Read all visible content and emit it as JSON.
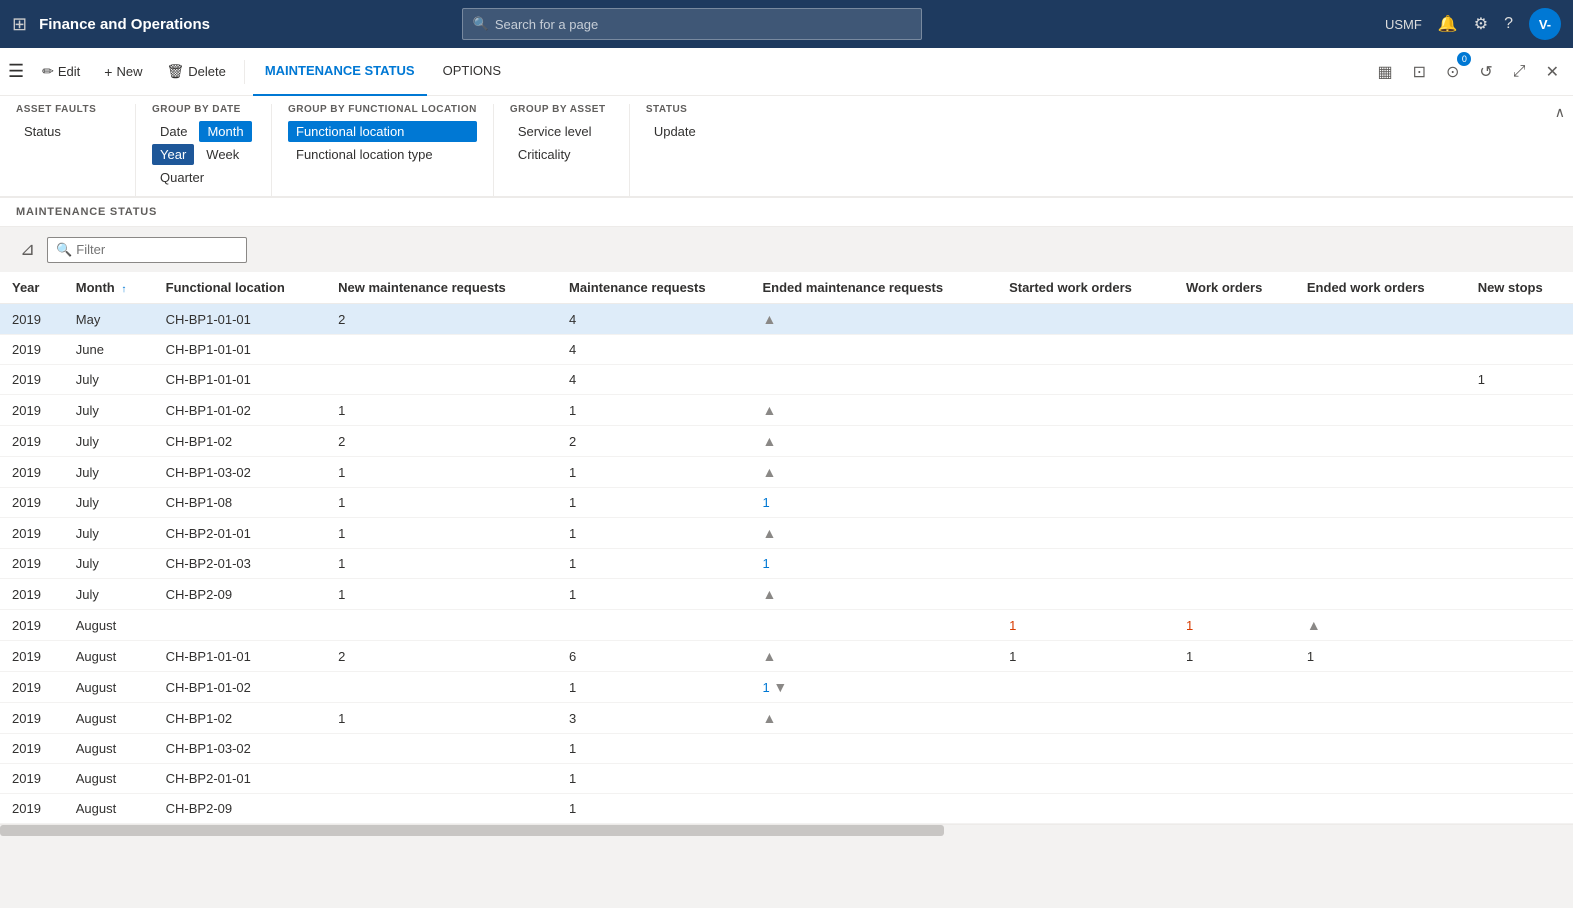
{
  "app": {
    "title": "Finance and Operations",
    "search_placeholder": "Search for a page"
  },
  "top_bar": {
    "username": "USMF",
    "avatar_initials": "V-",
    "notification_count": "0"
  },
  "command_bar": {
    "edit_label": "Edit",
    "new_label": "New",
    "delete_label": "Delete",
    "tab_maintenance": "MAINTENANCE STATUS",
    "tab_options": "OPTIONS"
  },
  "ribbon": {
    "asset_faults": {
      "title": "ASSET FAULTS",
      "items": [
        "Status"
      ]
    },
    "group_by_date": {
      "title": "GROUP BY DATE",
      "items": [
        "Date",
        "Month",
        "Year",
        "Week",
        "Quarter"
      ],
      "selected": "Month",
      "secondary_selected": "Year"
    },
    "group_by_functional_location": {
      "title": "GROUP BY FUNCTIONAL LOCATION",
      "items": [
        "Functional location",
        "Functional location type"
      ],
      "selected": "Functional location"
    },
    "group_by_asset": {
      "title": "GROUP BY ASSET",
      "items": [
        "Service level",
        "Criticality"
      ]
    },
    "status": {
      "title": "STATUS",
      "items": [
        "Update"
      ]
    }
  },
  "section": {
    "title": "MAINTENANCE STATUS"
  },
  "filter": {
    "placeholder": "Filter"
  },
  "table": {
    "columns": [
      "Year",
      "Month",
      "Functional location",
      "New maintenance requests",
      "Maintenance requests",
      "Ended maintenance requests",
      "Started work orders",
      "Work orders",
      "Ended work orders",
      "New stops"
    ],
    "rows": [
      {
        "year": "2019",
        "month": "May",
        "location": "CH-BP1-01-01",
        "new_mr": "2",
        "mr": "4",
        "ended_mr": "▲",
        "started_wo": "",
        "wo": "",
        "ended_wo": "",
        "new_stops": "",
        "selected": true
      },
      {
        "year": "2019",
        "month": "June",
        "location": "CH-BP1-01-01",
        "new_mr": "",
        "mr": "4",
        "ended_mr": "",
        "started_wo": "",
        "wo": "",
        "ended_wo": "",
        "new_stops": ""
      },
      {
        "year": "2019",
        "month": "July",
        "location": "CH-BP1-01-01",
        "new_mr": "",
        "mr": "4",
        "ended_mr": "",
        "started_wo": "",
        "wo": "",
        "ended_wo": "",
        "new_stops": "1"
      },
      {
        "year": "2019",
        "month": "July",
        "location": "CH-BP1-01-02",
        "new_mr": "1",
        "mr": "1",
        "ended_mr": "▲",
        "started_wo": "",
        "wo": "",
        "ended_wo": "",
        "new_stops": ""
      },
      {
        "year": "2019",
        "month": "July",
        "location": "CH-BP1-02",
        "new_mr": "2",
        "mr": "2",
        "ended_mr": "▲",
        "started_wo": "",
        "wo": "",
        "ended_wo": "",
        "new_stops": ""
      },
      {
        "year": "2019",
        "month": "July",
        "location": "CH-BP1-03-02",
        "new_mr": "1",
        "mr": "1",
        "ended_mr": "▲",
        "started_wo": "",
        "wo": "",
        "ended_wo": "",
        "new_stops": ""
      },
      {
        "year": "2019",
        "month": "July",
        "location": "CH-BP1-08",
        "new_mr": "1",
        "mr": "1",
        "ended_mr": "1",
        "started_wo": "",
        "wo": "",
        "ended_wo": "",
        "new_stops": ""
      },
      {
        "year": "2019",
        "month": "July",
        "location": "CH-BP2-01-01",
        "new_mr": "1",
        "mr": "1",
        "ended_mr": "▲",
        "started_wo": "",
        "wo": "",
        "ended_wo": "",
        "new_stops": ""
      },
      {
        "year": "2019",
        "month": "July",
        "location": "CH-BP2-01-03",
        "new_mr": "1",
        "mr": "1",
        "ended_mr": "1",
        "started_wo": "",
        "wo": "",
        "ended_wo": "",
        "new_stops": ""
      },
      {
        "year": "2019",
        "month": "July",
        "location": "CH-BP2-09",
        "new_mr": "1",
        "mr": "1",
        "ended_mr": "▲",
        "started_wo": "",
        "wo": "",
        "ended_wo": "",
        "new_stops": ""
      },
      {
        "year": "2019",
        "month": "August",
        "location": "",
        "new_mr": "",
        "mr": "",
        "ended_mr": "",
        "started_wo": "1",
        "wo": "1",
        "ended_wo": "▲",
        "new_stops": "",
        "orange": true
      },
      {
        "year": "2019",
        "month": "August",
        "location": "CH-BP1-01-01",
        "new_mr": "2",
        "mr": "6",
        "ended_mr": "▲",
        "started_wo": "1",
        "wo": "1",
        "ended_wo": "1",
        "new_stops": ""
      },
      {
        "year": "2019",
        "month": "August",
        "location": "CH-BP1-01-02",
        "new_mr": "",
        "mr": "1",
        "ended_mr": "1▼",
        "started_wo": "",
        "wo": "",
        "ended_wo": "",
        "new_stops": ""
      },
      {
        "year": "2019",
        "month": "August",
        "location": "CH-BP1-02",
        "new_mr": "1",
        "mr": "3",
        "ended_mr": "▲",
        "started_wo": "",
        "wo": "",
        "ended_wo": "",
        "new_stops": ""
      },
      {
        "year": "2019",
        "month": "August",
        "location": "CH-BP1-03-02",
        "new_mr": "",
        "mr": "1",
        "ended_mr": "",
        "started_wo": "",
        "wo": "",
        "ended_wo": "",
        "new_stops": ""
      },
      {
        "year": "2019",
        "month": "August",
        "location": "CH-BP2-01-01",
        "new_mr": "",
        "mr": "1",
        "ended_mr": "",
        "started_wo": "",
        "wo": "",
        "ended_wo": "",
        "new_stops": ""
      },
      {
        "year": "2019",
        "month": "August",
        "location": "CH-BP2-09",
        "new_mr": "",
        "mr": "1",
        "ended_mr": "",
        "started_wo": "",
        "wo": "",
        "ended_wo": "",
        "new_stops": ""
      }
    ]
  }
}
